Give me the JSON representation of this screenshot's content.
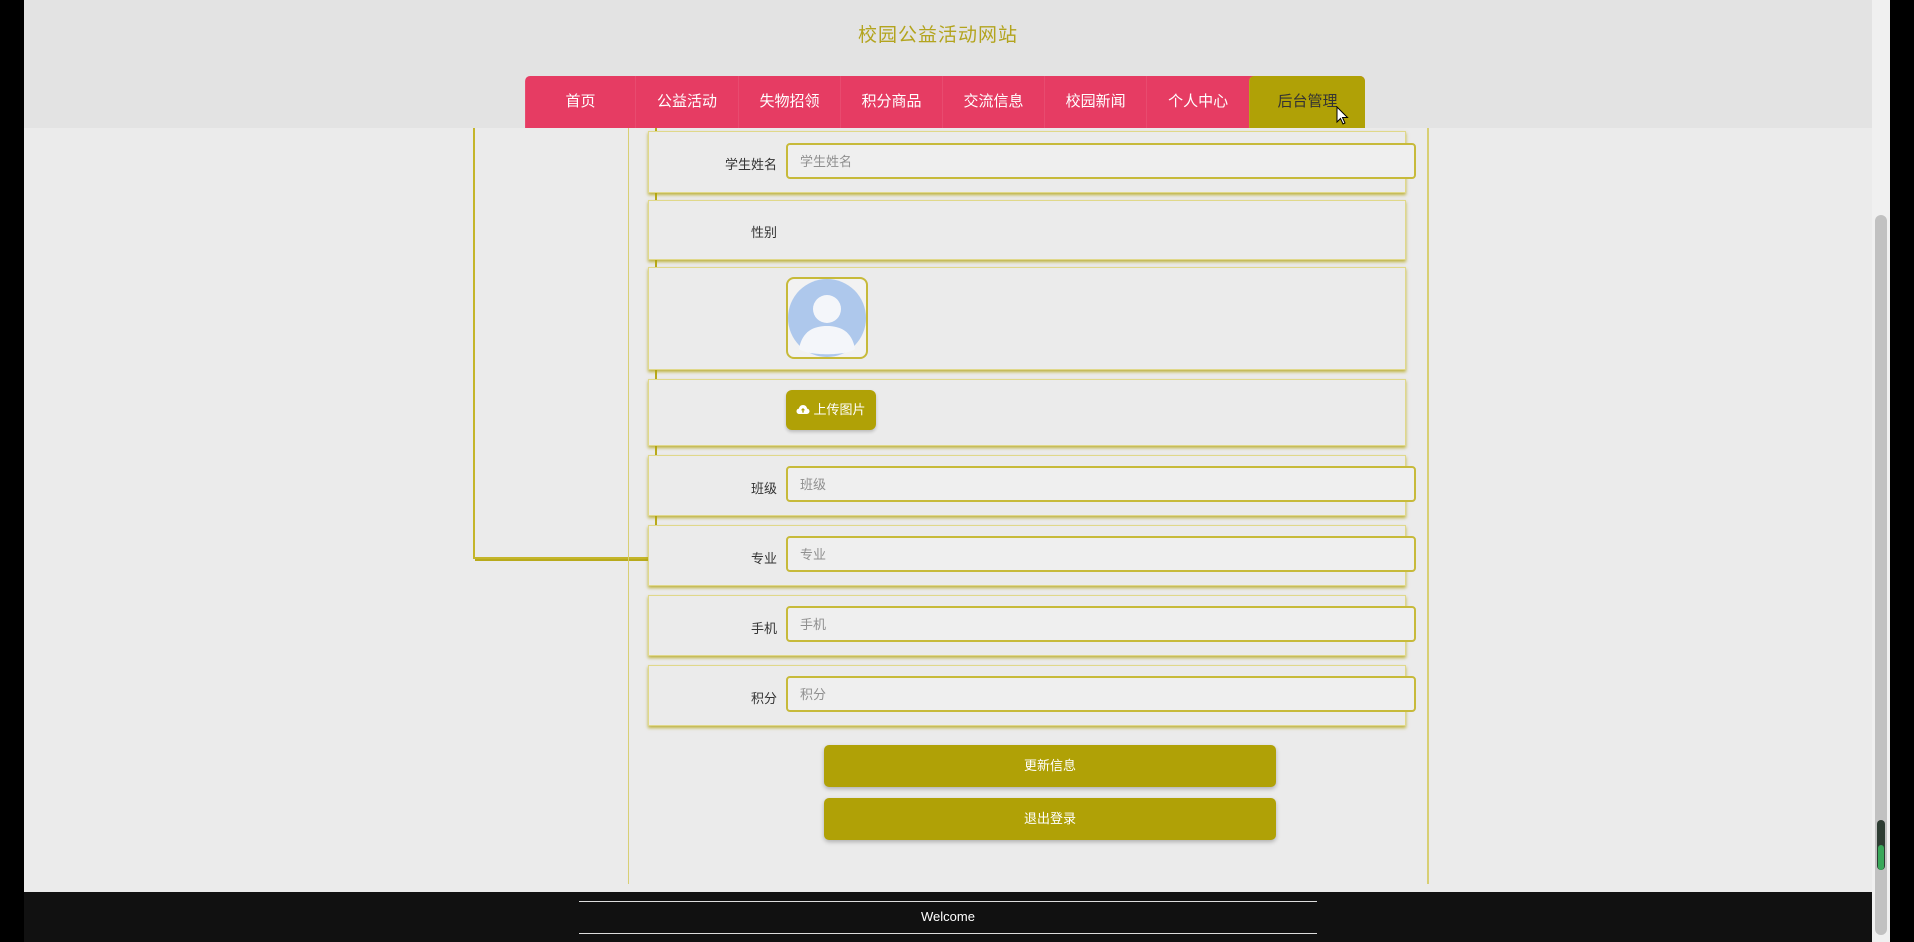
{
  "site": {
    "title": "校园公益活动网站"
  },
  "nav": {
    "items": [
      {
        "label": "首页"
      },
      {
        "label": "公益活动"
      },
      {
        "label": "失物招领"
      },
      {
        "label": "积分商品"
      },
      {
        "label": "交流信息"
      },
      {
        "label": "校园新闻"
      },
      {
        "label": "个人中心"
      },
      {
        "label": "后台管理"
      }
    ],
    "active_index": 7
  },
  "form": {
    "name": {
      "label": "学生姓名",
      "placeholder": "学生姓名",
      "value": ""
    },
    "gender": {
      "label": "性别"
    },
    "upload_label": "上传图片",
    "class": {
      "label": "班级",
      "placeholder": "班级",
      "value": ""
    },
    "major": {
      "label": "专业",
      "placeholder": "专业",
      "value": ""
    },
    "phone": {
      "label": "手机",
      "placeholder": "手机",
      "value": ""
    },
    "points": {
      "label": "积分",
      "placeholder": "积分",
      "value": ""
    }
  },
  "buttons": {
    "update": "更新信息",
    "logout": "退出登录"
  },
  "footer": {
    "text": "Welcome"
  },
  "colors": {
    "accent": "#b0a106",
    "nav": "#e63c63",
    "title": "#b3a41e",
    "footer": "#111111"
  },
  "icons": {
    "upload": "cloud-upload-icon",
    "avatar": "default-avatar-icon",
    "cursor": "mouse-cursor-icon"
  }
}
